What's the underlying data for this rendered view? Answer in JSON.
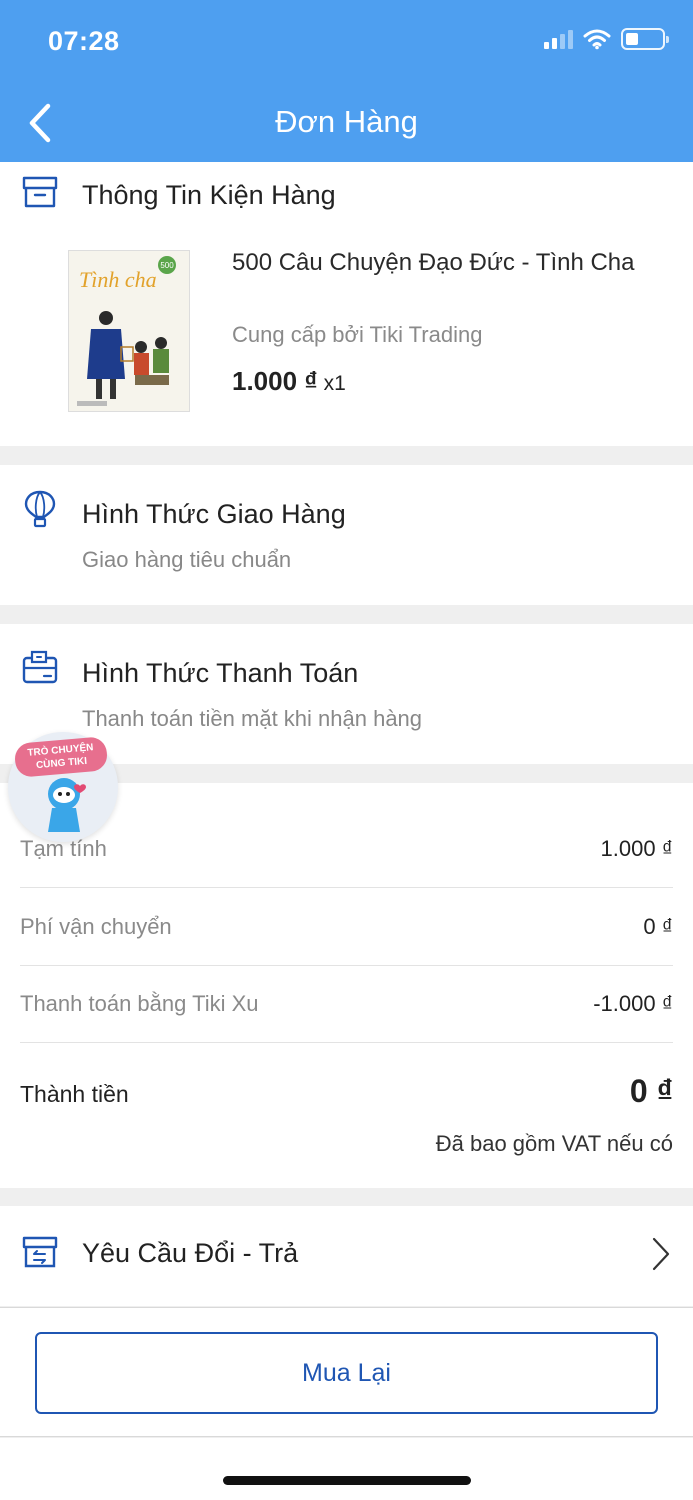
{
  "status_bar": {
    "time": "07:28"
  },
  "header": {
    "title": "Đơn Hàng"
  },
  "package": {
    "title": "Thông Tin Kiện Hàng",
    "product": {
      "name": "500 Câu Chuyện Đạo Đức - Tình Cha",
      "seller": "Cung cấp bởi Tiki Trading",
      "price": "1.000 ₫",
      "qty": "x1",
      "cover_title": "Tình cha",
      "cover_badge": "500"
    }
  },
  "shipping": {
    "title": "Hình Thức Giao Hàng",
    "value": "Giao hàng tiêu chuẩn"
  },
  "payment": {
    "title": "Hình Thức Thanh Toán",
    "value": "Thanh toán tiền mặt khi nhận hàng"
  },
  "summary": {
    "rows": [
      {
        "label": "Tạm tính",
        "value": "1.000 ₫"
      },
      {
        "label": "Phí vận chuyển",
        "value": "0 ₫"
      },
      {
        "label": "Thanh toán bằng Tiki Xu",
        "value": "-1.000 ₫"
      }
    ],
    "total_label": "Thành tiền",
    "total_value": "0 ₫",
    "vat_note": "Đã bao gồm VAT nếu có"
  },
  "returns": {
    "title": "Yêu Cầu Đổi - Trả"
  },
  "actions": {
    "buy_again": "Mua Lại"
  },
  "chat_widget": {
    "line1": "TRÒ CHUYỆN",
    "line2": "CÙNG TIKI"
  },
  "colors": {
    "header": "#4e9ff0",
    "icon_blue": "#1f56b3",
    "button_border": "#1f56b3"
  },
  "icons": [
    "back-icon",
    "box-icon",
    "balloon-icon",
    "payment-card-icon",
    "return-box-icon",
    "chevron-right-icon",
    "wifi-icon",
    "signal-icon",
    "battery-icon"
  ]
}
